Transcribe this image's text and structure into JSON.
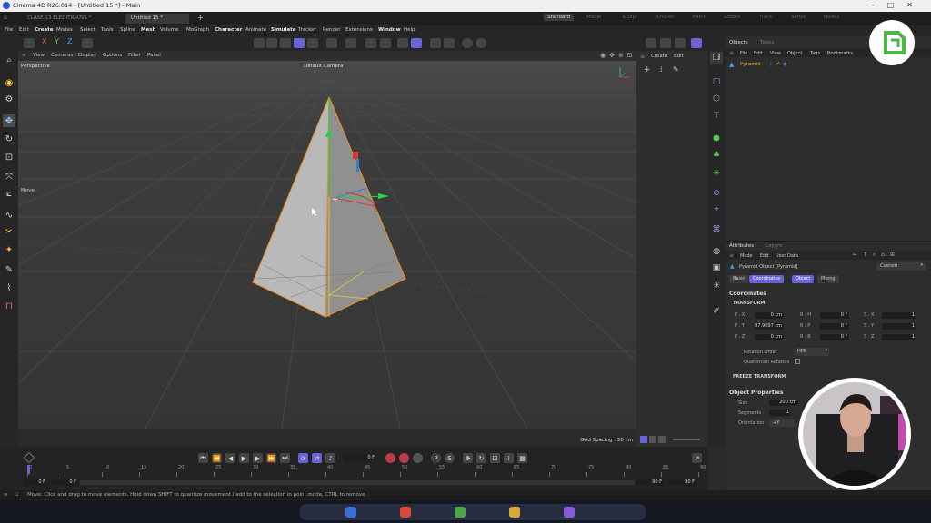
{
  "window": {
    "title": "Cinema 4D R26.014 - [Untitled 15 *] - Main",
    "controls": [
      "–",
      "□",
      "✕"
    ]
  },
  "doc_tabs": [
    {
      "label": "CLASE 13 ELEDITRAUSS *",
      "active": false
    },
    {
      "label": "Untitled 15 *",
      "active": true
    }
  ],
  "layout_tabs": [
    {
      "label": "Standard",
      "active": true
    },
    {
      "label": "Model",
      "active": false
    },
    {
      "label": "Sculpt",
      "active": false
    },
    {
      "label": "UVEdit",
      "active": false
    },
    {
      "label": "Paint",
      "active": false
    },
    {
      "label": "Groom",
      "active": false
    },
    {
      "label": "Track",
      "active": false
    },
    {
      "label": "Script",
      "active": false
    },
    {
      "label": "Nodes",
      "active": false
    }
  ],
  "menu": [
    "File",
    "Edit",
    "Create",
    "Modes",
    "Select",
    "Tools",
    "Spline",
    "Mesh",
    "Volume",
    "MoGraph",
    "Character",
    "Animate",
    "Simulate",
    "Tracker",
    "Render",
    "Extensions",
    "Window",
    "Help"
  ],
  "viewport": {
    "menu": [
      "View",
      "Cameras",
      "Display",
      "Options",
      "Filter",
      "Panel"
    ],
    "name": "Perspective",
    "camera": "Default Camera",
    "tool_label": "Move",
    "grid_spacing": "Grid Spacing : 50 cm"
  },
  "create_panel": {
    "menu": [
      "Create",
      "Edit"
    ]
  },
  "objects": {
    "tabs": [
      "Objects",
      "Takes"
    ],
    "menu": [
      "File",
      "Edit",
      "View",
      "Object",
      "Tags",
      "Bookmarks"
    ],
    "items": [
      {
        "name": "Pyramid"
      }
    ]
  },
  "attributes": {
    "tabs": [
      "Attributes",
      "Layers"
    ],
    "menu": [
      "Mode",
      "Edit",
      "User Data"
    ],
    "object_label": "Pyramid Object [Pyramid]",
    "preset": "Custom",
    "sub_tabs": [
      {
        "label": "Basic",
        "active": false
      },
      {
        "label": "Coordinates",
        "active": true
      },
      {
        "label": "Object",
        "active": true
      },
      {
        "label": "Phong",
        "active": false
      }
    ],
    "section": "Coordinates",
    "transform_label": "TRANSFORM",
    "rows": [
      {
        "p_label": "P . X",
        "p_val": "0 cm",
        "r_label": "R . H",
        "r_val": "0 °",
        "s_label": "S . X",
        "s_val": "1"
      },
      {
        "p_label": "P . Y",
        "p_val": "87.9097 cm",
        "r_label": "R . P",
        "r_val": "0 °",
        "s_label": "S . Y",
        "s_val": "1"
      },
      {
        "p_label": "P . Z",
        "p_val": "0 cm",
        "r_label": "R . B",
        "r_val": "0 °",
        "s_label": "S . Z",
        "s_val": "1"
      }
    ],
    "rotation_order_label": "Rotation Order",
    "rotation_order_value": "HPB",
    "quaternion_label": "Quaternion Rotation",
    "freeze_label": "FREEZE TRANSFORM",
    "object_props_title": "Object Properties",
    "size_label": "Size",
    "size_value": "200 cm",
    "segments_label": "Segments",
    "segments_value": "1",
    "orientation_label": "Orientation",
    "orientation_value": "+Y"
  },
  "timeline": {
    "current_frame": "0 F",
    "ticks": [
      "0",
      "5",
      "10",
      "15",
      "20",
      "25",
      "30",
      "35",
      "40",
      "45",
      "50",
      "55",
      "60",
      "65",
      "70",
      "75",
      "80",
      "85",
      "90"
    ],
    "start": "0 F",
    "start2": "0 F",
    "end": "90 F",
    "end2": "90 F"
  },
  "status_text": "Move: Click and drag to move elements. Hold down SHIFT to quantize movement / add to the selection in point mode, CTRL to remove."
}
